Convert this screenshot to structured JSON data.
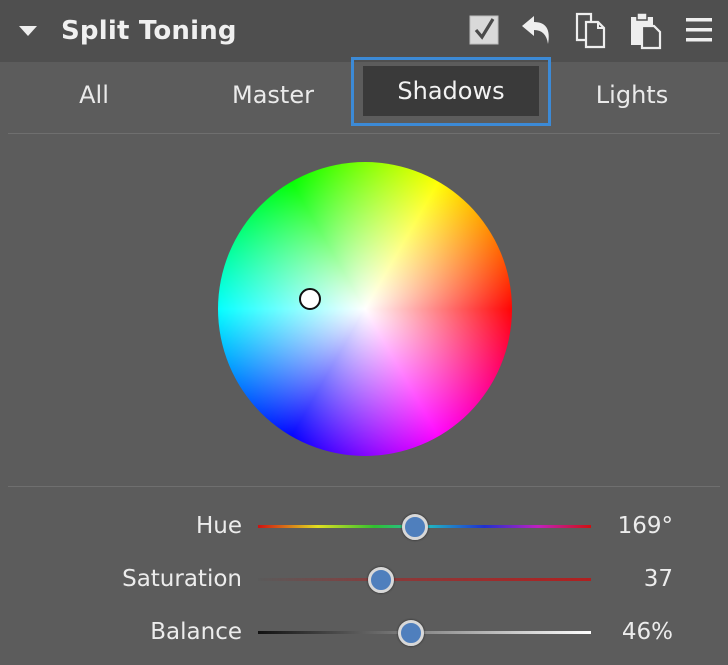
{
  "panel": {
    "title": "Split Toning"
  },
  "header_icons": [
    "checkbox-checked-icon",
    "undo-icon",
    "copy-icon",
    "paste-icon",
    "menu-icon"
  ],
  "tabs": [
    {
      "label": "All",
      "active": false
    },
    {
      "label": "Master",
      "active": false
    },
    {
      "label": "Shadows",
      "active": true
    },
    {
      "label": "Lights",
      "active": false
    }
  ],
  "color_wheel": {
    "selected_hue_deg": 169,
    "selected_saturation": 37
  },
  "sliders": {
    "hue": {
      "label": "Hue",
      "value": "169°",
      "level": 0.47
    },
    "saturation": {
      "label": "Saturation",
      "value": "37",
      "level": 0.37
    },
    "balance": {
      "label": "Balance",
      "value": "46%",
      "level": 0.46
    }
  },
  "colors": {
    "panel_bg": "#5c5c5c",
    "header_bg": "#4f4f4f",
    "active_tab_outline": "#3c8ad6",
    "active_tab_bg": "#3a3a3a",
    "knob_fill": "#4f7fbd"
  }
}
